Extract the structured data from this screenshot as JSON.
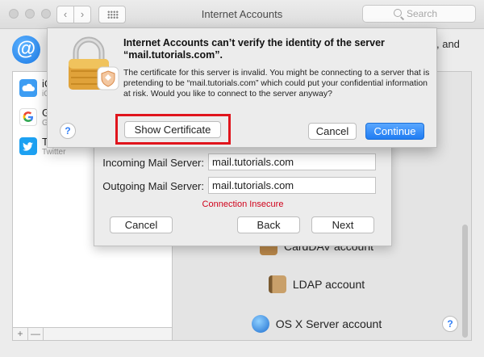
{
  "window": {
    "title": "Internet Accounts"
  },
  "toolbar": {
    "back_label": "‹",
    "forward_label": "›",
    "search_placeholder": "Search"
  },
  "header": {
    "intro_tail": ", and"
  },
  "sidebar": {
    "accounts": [
      {
        "name": "iC",
        "sub": "iC",
        "icon": "icloud-icon",
        "color": "#3d9df3"
      },
      {
        "name": "G",
        "sub": "G",
        "icon": "google-icon",
        "color": "#ffffff"
      },
      {
        "name": "T",
        "sub": "Twitter",
        "icon": "twitter-icon",
        "color": "#1da1f2"
      }
    ],
    "add_label": "+",
    "remove_label": "—"
  },
  "providers": [
    {
      "label": "CardDAV account",
      "icon": "carddav-icon"
    },
    {
      "label": "LDAP account",
      "icon": "ldap-icon"
    },
    {
      "label": "OS X Server account",
      "icon": "osx-server-icon"
    }
  ],
  "sheet": {
    "incoming_label": "Incoming Mail Server:",
    "incoming_value": "mail.tutorials.com",
    "outgoing_label": "Outgoing Mail Server:",
    "outgoing_value": "mail.tutorials.com",
    "connection_status": "Connection Insecure",
    "cancel_label": "Cancel",
    "back_label": "Back",
    "next_label": "Next"
  },
  "alert": {
    "title_line1": "Internet Accounts can’t verify the identity of the server",
    "title_line2": "“mail.tutorials.com”.",
    "body": "The certificate for this server is invalid. You might be connecting to a server that is pretending to be “mail.tutorials.com” which could put your confidential information at risk. Would you like to connect to the server anyway?",
    "show_certificate_label": "Show Certificate",
    "cancel_label": "Cancel",
    "continue_label": "Continue",
    "help_label": "?"
  },
  "help_label": "?",
  "colors": {
    "accent": "#1f7cf2",
    "warning": "#d0021b",
    "highlight": "#e0141c"
  }
}
